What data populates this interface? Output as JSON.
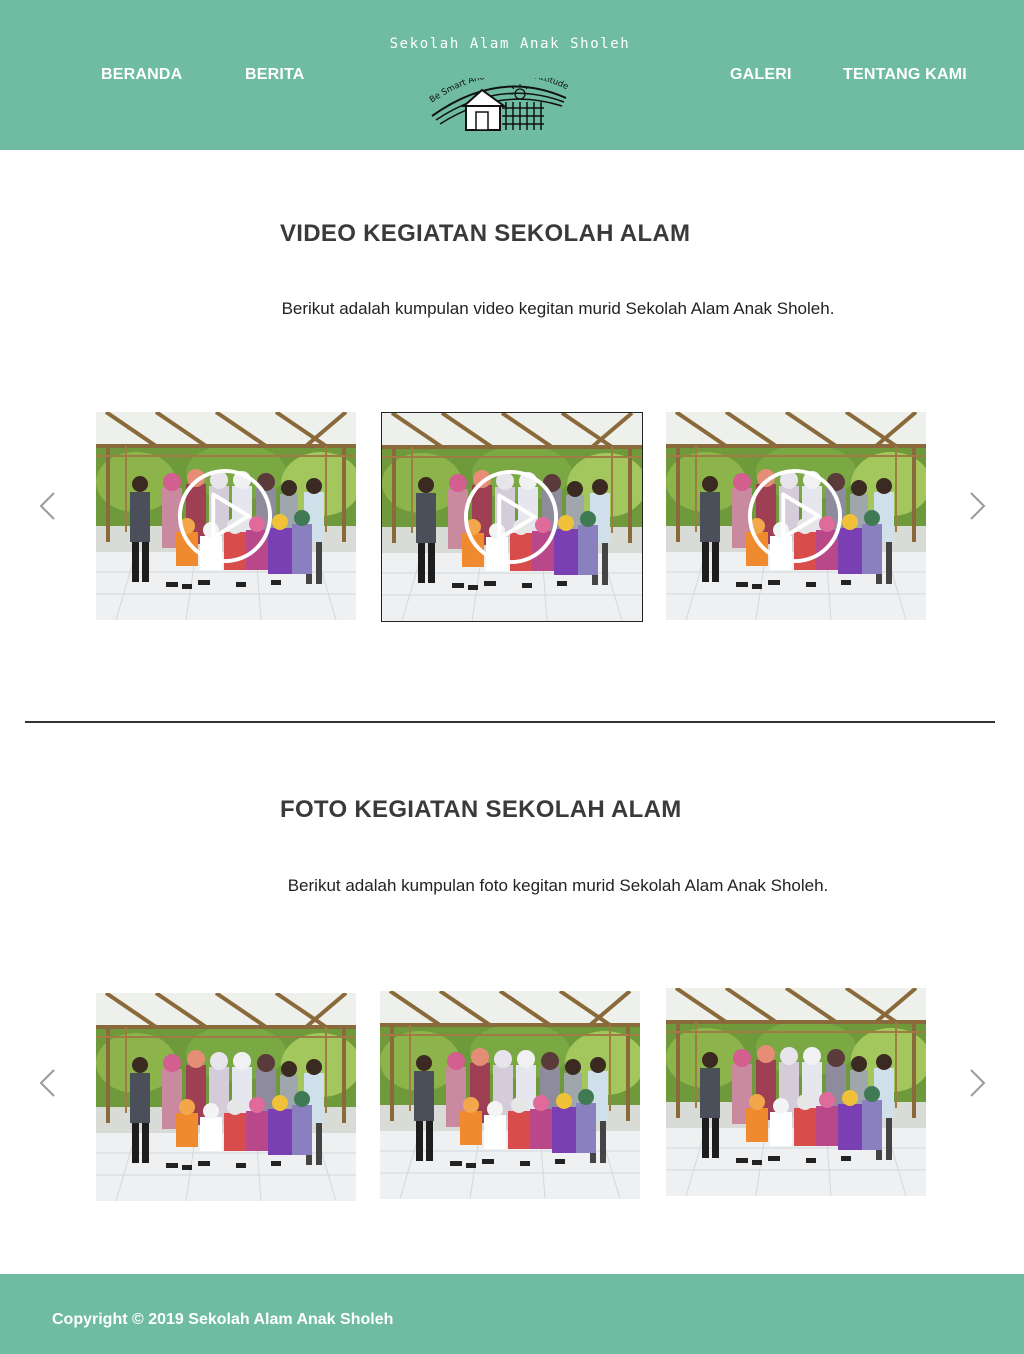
{
  "header": {
    "nav_left": [
      "BERANDA",
      "BERITA"
    ],
    "nav_right": [
      "GALERI",
      "TENTANG KAMI"
    ],
    "brand_name": "Sekolah Alam Anak Sholeh",
    "logo_tagline": "Be Smart And Be A Good Attitude"
  },
  "video_section": {
    "title": "VIDEO KEGIATAN SEKOLAH ALAM",
    "description": "Berikut adalah kumpulan video kegitan murid Sekolah Alam Anak Sholeh."
  },
  "foto_section": {
    "title": "FOTO KEGIATAN SEKOLAH ALAM",
    "description": "Berikut adalah kumpulan foto kegitan murid Sekolah Alam Anak Sholeh."
  },
  "footer": {
    "copyright": "Copyright  © 2019 Sekolah Alam Anak Sholeh"
  },
  "colors": {
    "header_bg": "#6fbca3",
    "footer_bg": "#6fbca3",
    "nav_text": "#ffffff"
  },
  "icons": {
    "prev": "chevron-left-icon",
    "next": "chevron-right-icon",
    "play": "play-circle-icon"
  }
}
